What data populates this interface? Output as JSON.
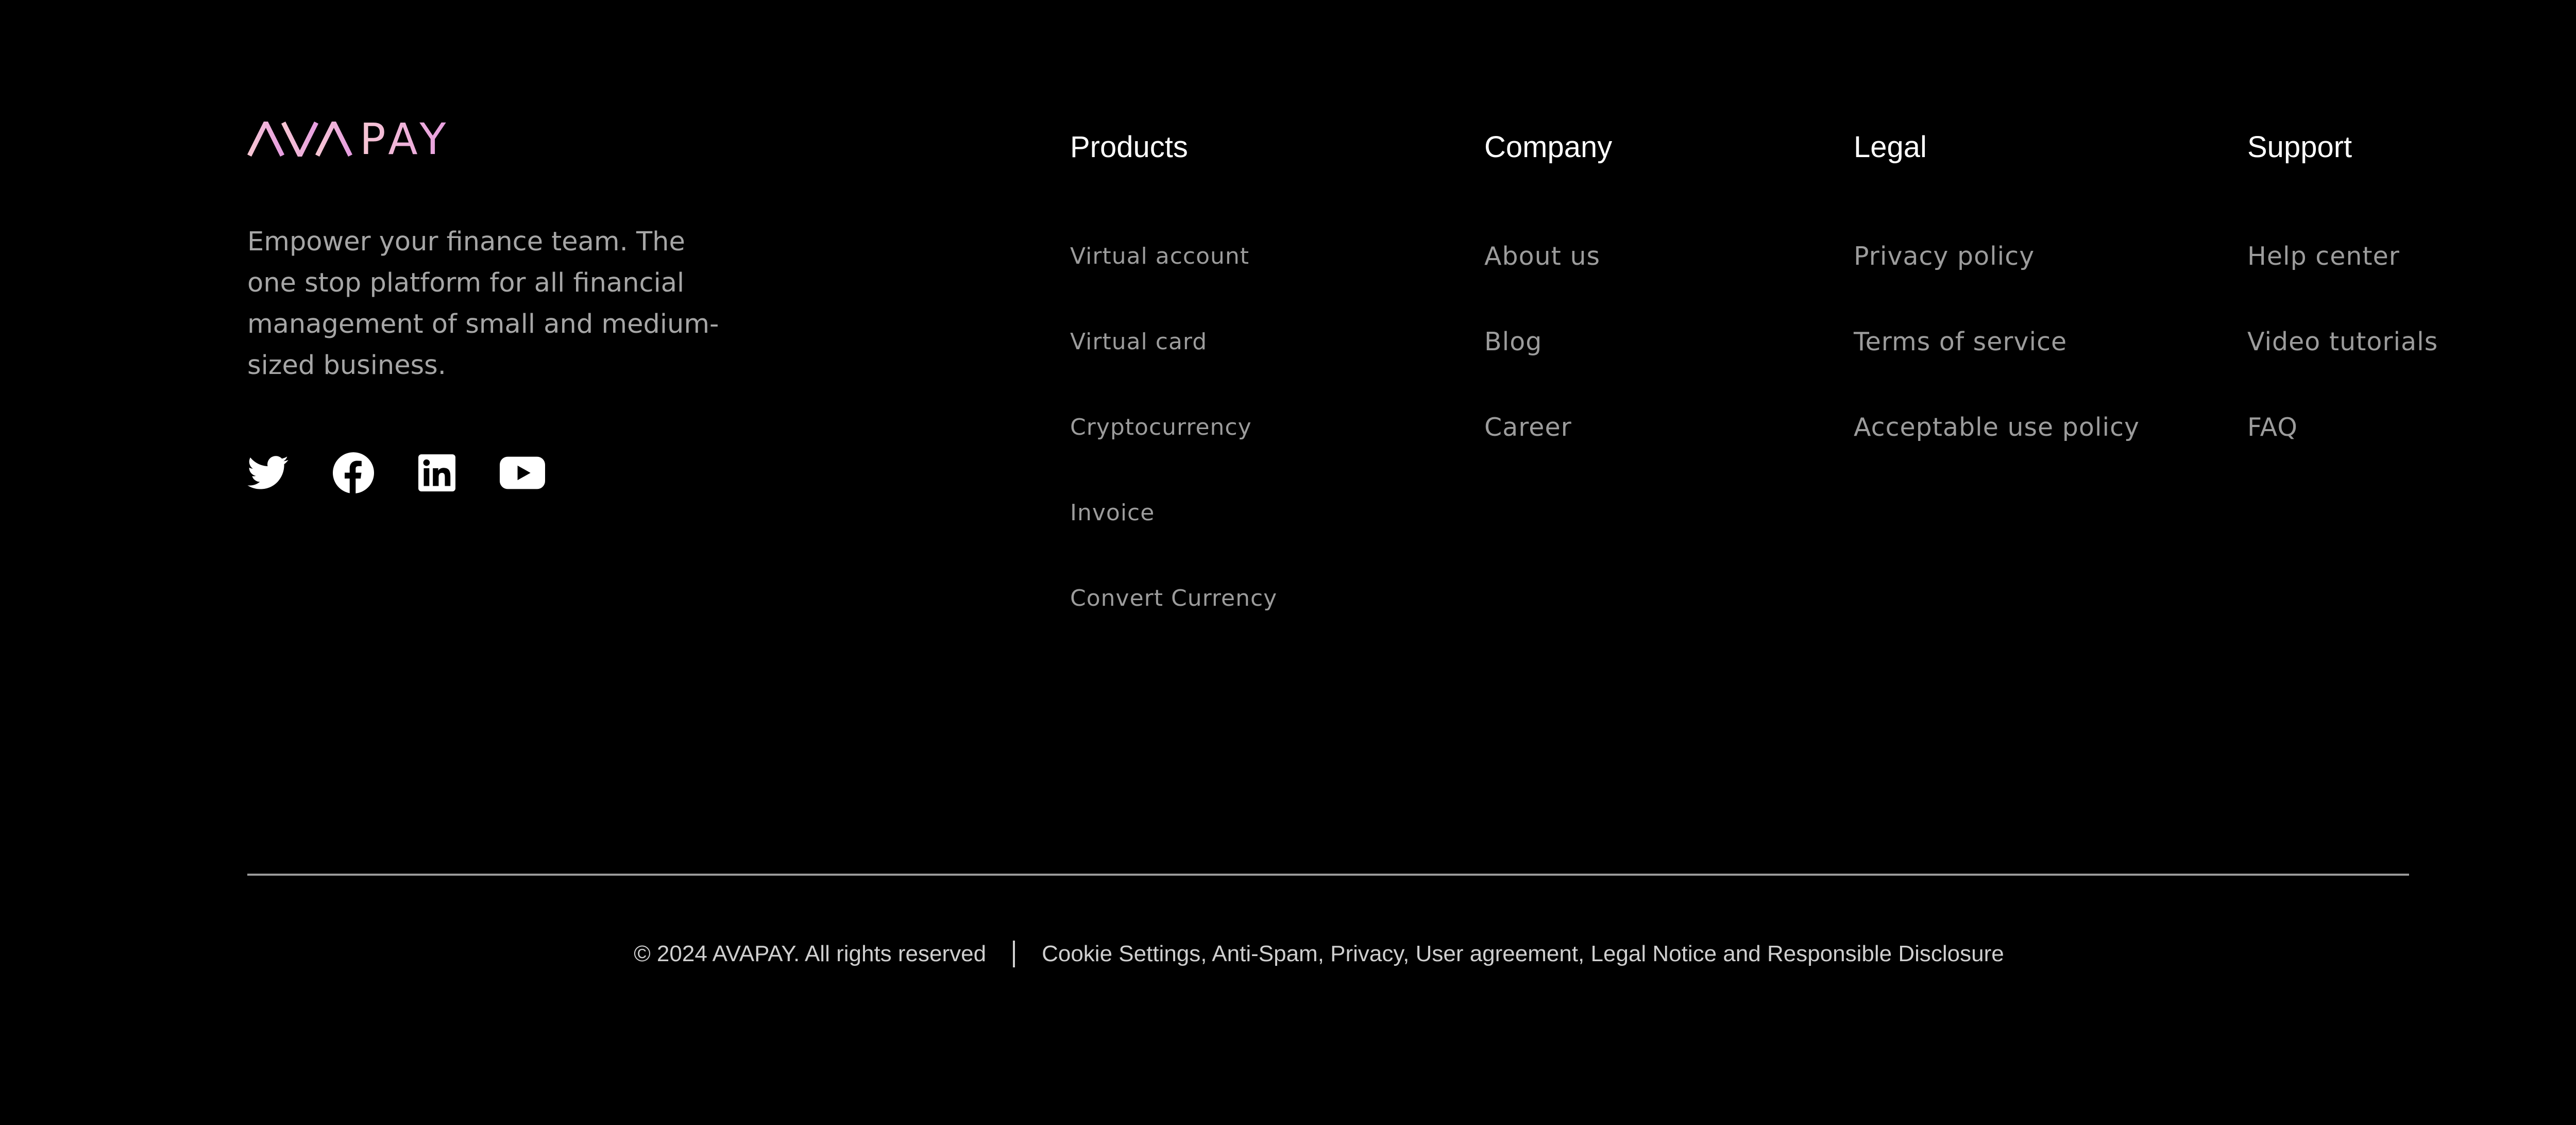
{
  "brand": {
    "logo_text": "PAY",
    "logo_mark": "AVA",
    "tagline": "Empower your finance team. The one stop platform for all financial management of small and medium-sized business."
  },
  "socials": [
    {
      "name": "twitter",
      "icon": "twitter-icon"
    },
    {
      "name": "facebook",
      "icon": "facebook-icon"
    },
    {
      "name": "linkedin",
      "icon": "linkedin-icon"
    },
    {
      "name": "youtube",
      "icon": "youtube-icon"
    }
  ],
  "columns": {
    "products": {
      "title": "Products",
      "links": [
        "Virtual account",
        "Virtual card",
        "Cryptocurrency",
        "Invoice",
        "Convert Currency"
      ]
    },
    "company": {
      "title": "Company",
      "links": [
        "About us",
        "Blog",
        "Career"
      ]
    },
    "legal": {
      "title": "Legal",
      "links": [
        "Privacy policy",
        "Terms of service",
        "Acceptable use policy"
      ]
    },
    "support": {
      "title": "Support",
      "links": [
        "Help center",
        "Video tutorials",
        "FAQ"
      ]
    }
  },
  "bottom": {
    "copyright": "© 2024 AVAPAY. All rights reserved",
    "legal_links": "Cookie Settings, Anti-Spam, Privacy, User agreement, Legal Notice and Responsible Disclosure"
  },
  "colors": {
    "background": "#000000",
    "logo_gradient_start": "#f7c6d3",
    "logo_gradient_end": "#e69de0",
    "muted_text": "#9c9c9c"
  }
}
